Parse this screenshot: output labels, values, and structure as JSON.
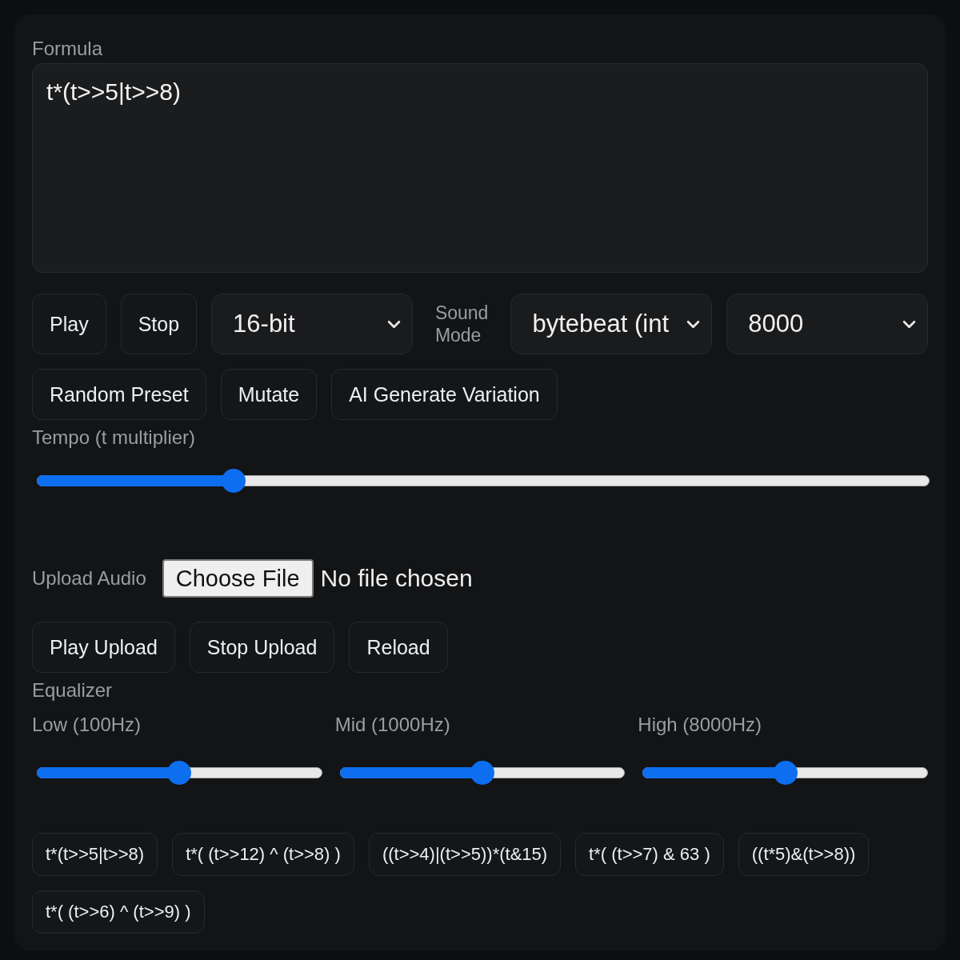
{
  "formula": {
    "label": "Formula",
    "value": "t*(t>>5|t>>8)"
  },
  "controls": [
    {
      "kind": "button",
      "label": "Play"
    },
    {
      "kind": "button",
      "label": "Stop"
    },
    {
      "kind": "dropdown",
      "value": "16-bit"
    },
    {
      "kind": "label",
      "text": "Sound Mode"
    },
    {
      "kind": "dropdown",
      "value": "bytebeat (int"
    },
    {
      "kind": "dropdown",
      "value": "8000"
    }
  ],
  "actions": [
    "Random Preset",
    "Mutate",
    "AI Generate Variation"
  ],
  "tempo": {
    "label": "Tempo (t multiplier)",
    "level": 0.22
  },
  "upload": {
    "label": "Upload Audio",
    "button": "Choose File",
    "status": "No file chosen"
  },
  "upload_buttons": [
    "Play Upload",
    "Stop Upload",
    "Reload"
  ],
  "equalizer": {
    "title": "Equalizer",
    "bands": [
      {
        "label": "Low (100Hz)",
        "level": 0.5
      },
      {
        "label": "Mid (1000Hz)",
        "level": 0.5
      },
      {
        "label": "High (8000Hz)",
        "level": 0.5
      }
    ]
  },
  "presets": [
    "t*(t>>5|t>>8)",
    "t*( (t>>12) ^ (t>>8) )",
    "((t>>4)|(t>>5))*(t&15)",
    "t*( (t>>7) & 63 )",
    "((t*5)&(t>>8))",
    "t*( (t>>6) ^ (t>>9) )"
  ]
}
